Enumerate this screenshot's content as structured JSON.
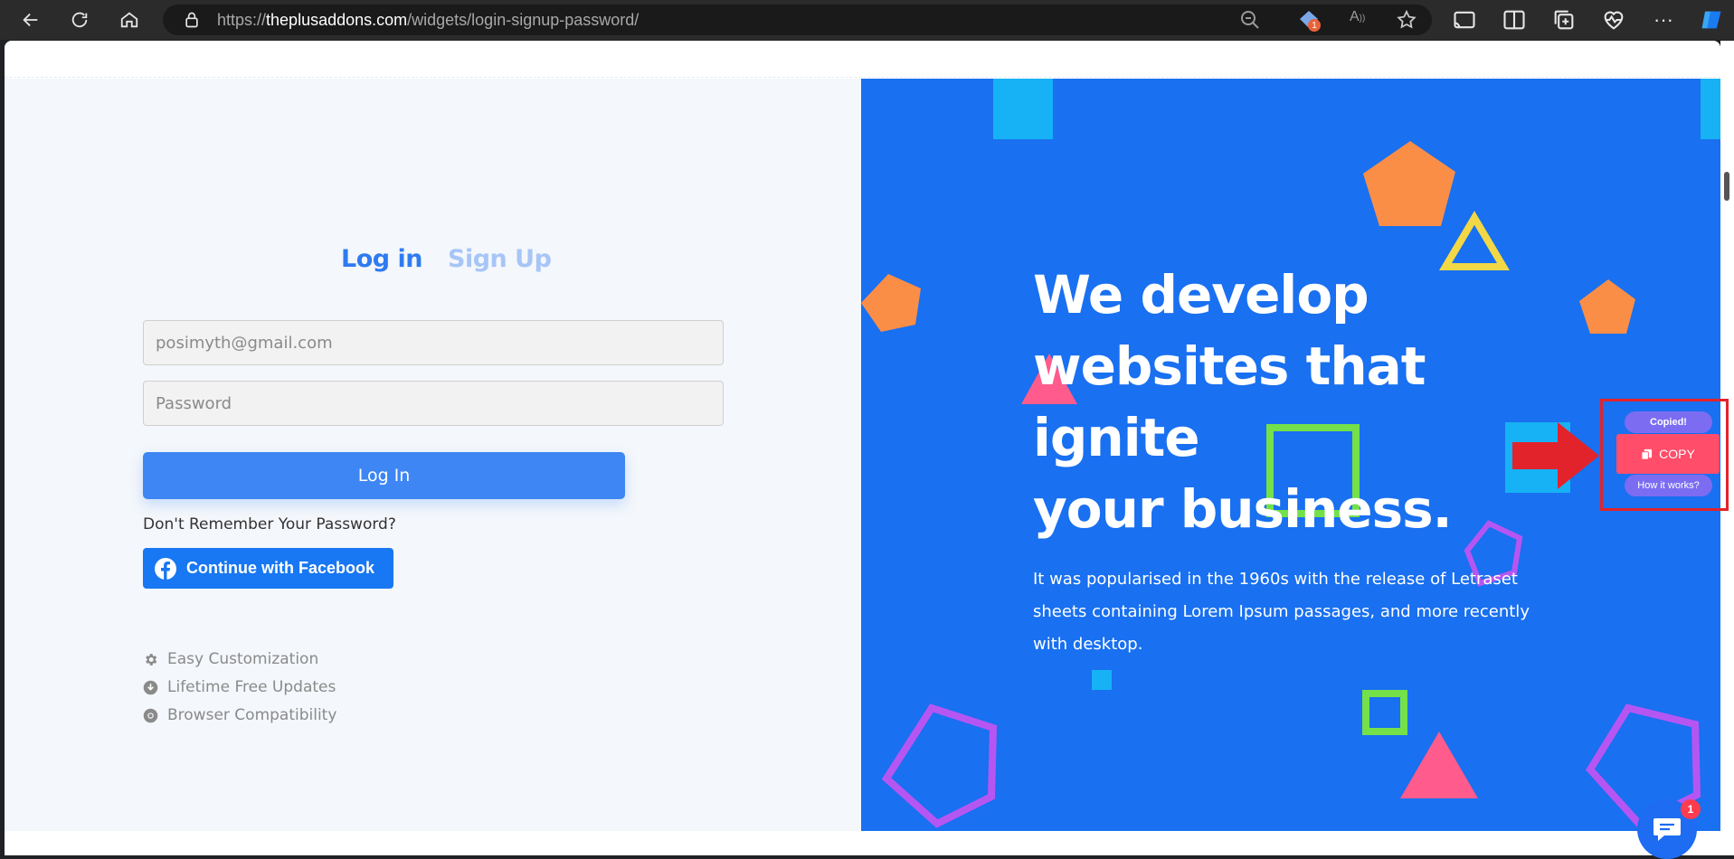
{
  "browser": {
    "url_prefix": "https://",
    "url_domain": "theplusaddons.com",
    "url_path": "/widgets/login-signup-password/",
    "extension_badge": "1"
  },
  "login_form": {
    "tab_login": "Log in",
    "tab_signup": "Sign Up",
    "email_placeholder": "posimyth@gmail.com",
    "password_placeholder": "Password",
    "login_button": "Log In",
    "forgot_text": "Don't Remember Your Password?",
    "facebook_button": "Continue with Facebook"
  },
  "features": [
    {
      "icon": "gear-icon",
      "label": "Easy Customization"
    },
    {
      "icon": "download-circle-icon",
      "label": "Lifetime Free Updates"
    },
    {
      "icon": "chrome-icon",
      "label": "Browser Compatibility"
    }
  ],
  "hero": {
    "title_line1": "We develop",
    "title_line2": "websites that ignite",
    "title_line3": "your business.",
    "text_line1": "It was popularised in the 1960s with the release of Letraset",
    "text_line2": "sheets containing Lorem Ipsum passages, and more recently",
    "text_line3": "with desktop."
  },
  "copy_widget": {
    "copied_label": "Copied!",
    "copy_label": "COPY",
    "how_label": "How it works?"
  },
  "chat": {
    "badge_count": "1"
  },
  "colors": {
    "accent_blue": "#3d86f3",
    "hero_blue": "#1970f0",
    "copy_red": "#ff4d6a",
    "annotation_red": "#e3232b"
  }
}
